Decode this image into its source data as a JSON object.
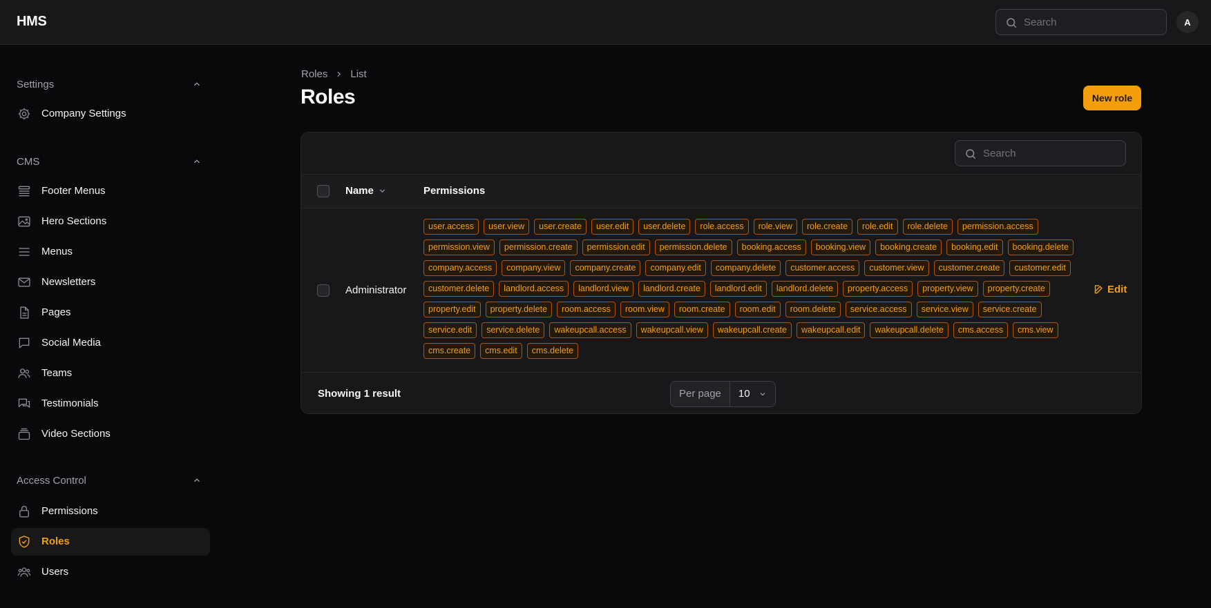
{
  "app": {
    "brand": "HMS",
    "search_placeholder": "Search",
    "avatar_initial": "A"
  },
  "sidebar": {
    "groups": [
      {
        "label": "Settings",
        "items": [
          {
            "label": "Company Settings",
            "icon": "gear-icon"
          }
        ]
      },
      {
        "label": "CMS",
        "items": [
          {
            "label": "Footer Menus",
            "icon": "stack-icon"
          },
          {
            "label": "Hero Sections",
            "icon": "photo-icon"
          },
          {
            "label": "Menus",
            "icon": "menu-icon"
          },
          {
            "label": "Newsletters",
            "icon": "envelope-icon"
          },
          {
            "label": "Pages",
            "icon": "document-icon"
          },
          {
            "label": "Social Media",
            "icon": "chat-bubble-icon"
          },
          {
            "label": "Teams",
            "icon": "users-icon"
          },
          {
            "label": "Testimonials",
            "icon": "chat-bubbles-icon"
          },
          {
            "label": "Video Sections",
            "icon": "archive-icon"
          }
        ]
      },
      {
        "label": "Access Control",
        "items": [
          {
            "label": "Permissions",
            "icon": "lock-icon"
          },
          {
            "label": "Roles",
            "icon": "shield-check-icon",
            "active": true
          },
          {
            "label": "Users",
            "icon": "user-group-icon"
          }
        ]
      }
    ]
  },
  "page": {
    "breadcrumb": [
      "Roles",
      "List"
    ],
    "title": "Roles",
    "new_button": "New role"
  },
  "table": {
    "search_placeholder": "Search",
    "columns": {
      "name": "Name",
      "permissions": "Permissions"
    },
    "rows": [
      {
        "name": "Administrator",
        "permissions": [
          "user.access",
          "user.view",
          "user.create",
          "user.edit",
          "user.delete",
          "role.access",
          "role.view",
          "role.create",
          "role.edit",
          "role.delete",
          "permission.access",
          "permission.view",
          "permission.create",
          "permission.edit",
          "permission.delete",
          "booking.access",
          "booking.view",
          "booking.create",
          "booking.edit",
          "booking.delete",
          "company.access",
          "company.view",
          "company.create",
          "company.edit",
          "company.delete",
          "customer.access",
          "customer.view",
          "customer.create",
          "customer.edit",
          "customer.delete",
          "landlord.access",
          "landlord.view",
          "landlord.create",
          "landlord.edit",
          "landlord.delete",
          "property.access",
          "property.view",
          "property.create",
          "property.edit",
          "property.delete",
          "room.access",
          "room.view",
          "room.create",
          "room.edit",
          "room.delete",
          "service.access",
          "service.view",
          "service.create",
          "service.edit",
          "service.delete",
          "wakeupcall.access",
          "wakeupcall.view",
          "wakeupcall.create",
          "wakeupcall.edit",
          "wakeupcall.delete",
          "cms.access",
          "cms.view",
          "cms.create",
          "cms.edit",
          "cms.delete"
        ],
        "action": "Edit"
      }
    ],
    "footer": {
      "showing": "Showing 1 result",
      "per_page_label": "Per page",
      "per_page_value": "10"
    }
  },
  "colors": {
    "accent": "#f59e0b",
    "background": "#09090b",
    "surface": "#18181b"
  }
}
